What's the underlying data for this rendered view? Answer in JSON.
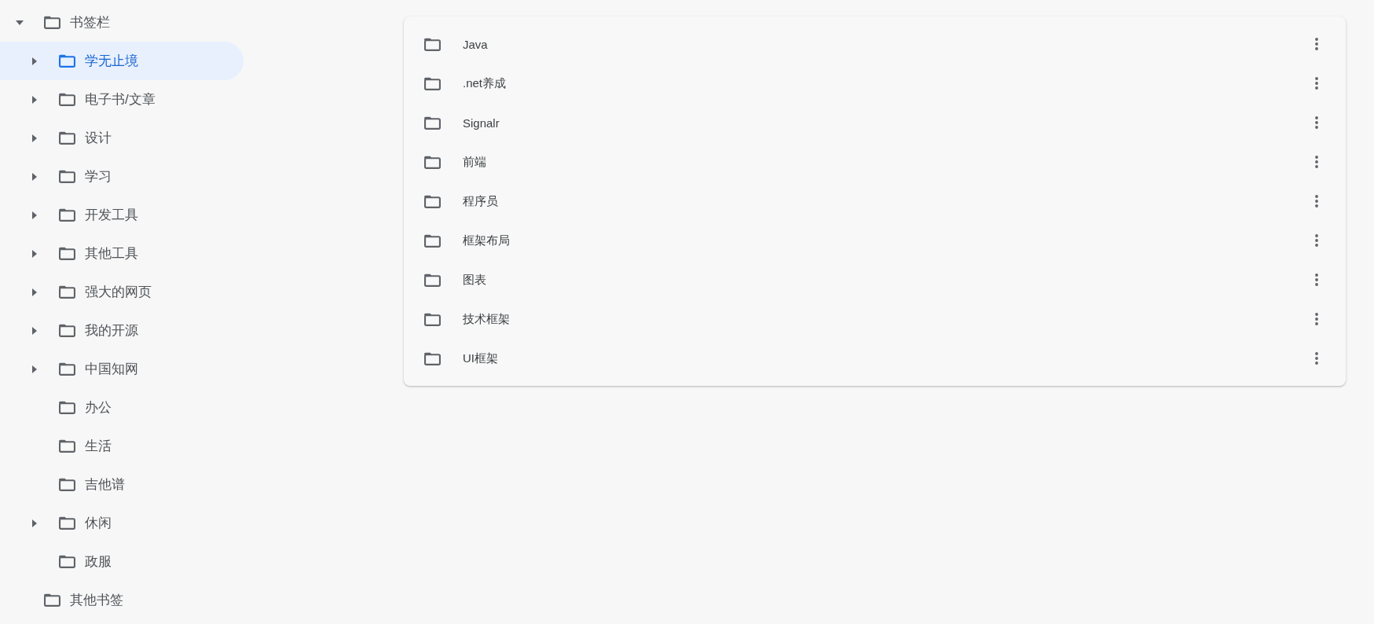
{
  "sidebar": {
    "tree": [
      {
        "label": "书签栏",
        "expandable": true,
        "expanded": true,
        "selected": false,
        "children": [
          {
            "label": "学无止境",
            "expandable": true,
            "expanded": false,
            "selected": true
          },
          {
            "label": "电子书/文章",
            "expandable": true,
            "expanded": false,
            "selected": false
          },
          {
            "label": "设计",
            "expandable": true,
            "expanded": false,
            "selected": false
          },
          {
            "label": "学习",
            "expandable": true,
            "expanded": false,
            "selected": false
          },
          {
            "label": "开发工具",
            "expandable": true,
            "expanded": false,
            "selected": false
          },
          {
            "label": "其他工具",
            "expandable": true,
            "expanded": false,
            "selected": false
          },
          {
            "label": "强大的网页",
            "expandable": true,
            "expanded": false,
            "selected": false
          },
          {
            "label": "我的开源",
            "expandable": true,
            "expanded": false,
            "selected": false
          },
          {
            "label": "中国知网",
            "expandable": true,
            "expanded": false,
            "selected": false
          },
          {
            "label": "办公",
            "expandable": false,
            "selected": false
          },
          {
            "label": "生活",
            "expandable": false,
            "selected": false
          },
          {
            "label": "吉他谱",
            "expandable": false,
            "selected": false
          },
          {
            "label": "休闲",
            "expandable": true,
            "expanded": false,
            "selected": false
          },
          {
            "label": "政服",
            "expandable": false,
            "selected": false
          }
        ]
      },
      {
        "label": "其他书签",
        "expandable": false,
        "selected": false
      }
    ]
  },
  "folder_list": {
    "items": [
      {
        "label": "Java"
      },
      {
        "label": ".net养成"
      },
      {
        "label": "Signalr"
      },
      {
        "label": "前端"
      },
      {
        "label": "程序员"
      },
      {
        "label": "框架布局"
      },
      {
        "label": "图表"
      },
      {
        "label": "技术框架"
      },
      {
        "label": "UI框架"
      }
    ]
  }
}
